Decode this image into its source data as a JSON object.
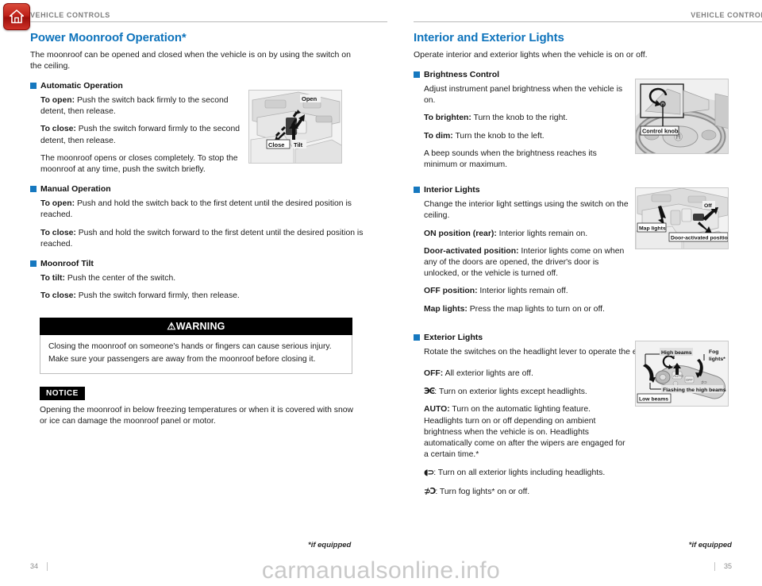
{
  "home_icon": {
    "name": "home-icon"
  },
  "left": {
    "header": "VEHICLE CONTROLS",
    "title": "Power Moonroof Operation*",
    "intro": "The moonroof can be opened and closed when the vehicle is on by using the switch on the ceiling.",
    "automatic": {
      "heading": "Automatic Operation",
      "p1_label": "To open:",
      "p1_text": " Push the switch back firmly to the second detent, then release.",
      "p2_label": "To close:",
      "p2_text": " Push the switch forward firmly to the second detent, then release.",
      "p3_text": "The moonroof opens or closes completely. To stop the moonroof at any time, push the switch briefly."
    },
    "manual": {
      "heading": "Manual Operation",
      "p1_label": "To open:",
      "p1_text": " Push and hold the switch back to the first detent until the desired position is reached.",
      "p2_label": "To close:",
      "p2_text": " Push and hold the switch forward  to the first detent until the desired position is reached."
    },
    "tilt": {
      "heading": "Moonroof Tilt",
      "p1_label": "To tilt:",
      "p1_text": " Push the center of the switch.",
      "p2_label": "To close:",
      "p2_text": " Push the switch forward firmly, then release."
    },
    "warning": {
      "bar": "⚠WARNING",
      "line1": "Closing the moonroof on someone's hands or fingers can cause serious injury.",
      "line2": "Make sure your passengers are away from the moonroof before closing it."
    },
    "notice": {
      "tag": "NOTICE",
      "body": "Opening the moonroof in below freezing temperatures or when it is covered with snow or ice can damage the moonroof panel or motor."
    },
    "figure_moonroof": {
      "name": "moonroof-switch-illustration",
      "labels": {
        "open": "Open",
        "close": "Close",
        "tilt": "Tilt"
      }
    },
    "footnote": "*if equipped",
    "page_number": "34"
  },
  "right": {
    "header": "VEHICLE CONTROLS",
    "title": "Interior and Exterior Lights",
    "intro": "Operate interior and exterior lights when the vehicle is on or off.",
    "brightness": {
      "heading": "Brightness Control",
      "p1_text": "Adjust instrument panel brightness when the vehicle is on.",
      "p2_label": "To brighten:",
      "p2_text": " Turn the knob to the right.",
      "p3_label": "To dim:",
      "p3_text": " Turn the knob to the left.",
      "p4_text": "A beep sounds when the brightness reaches its minimum or maximum."
    },
    "interior": {
      "heading": "Interior Lights",
      "p1_text": "Change the interior light settings using the switch on the ceiling.",
      "p2_label": "ON position (rear):",
      "p2_text": " Interior lights remain on.",
      "p3_label": "Door-activated position:",
      "p3_text": " Interior lights come on when any of the doors are opened, the driver's door is unlocked, or the vehicle is turned off.",
      "p4_label": "OFF position:",
      "p4_text": " Interior lights remain off.",
      "p5_label": "Map lights:",
      "p5_text": " Press the map lights to turn on or off."
    },
    "exterior": {
      "heading": "Exterior Lights",
      "p1_text": "Rotate the switches on the headlight lever to operate the exterior lights.",
      "off_label": "OFF:",
      "off_text": "  All exterior lights are off.",
      "park_symbol": "ЭϾ",
      "park_text": ":  Turn on exterior lights except headlights.",
      "auto_label": "AUTO:",
      "auto_text": "  Turn on the automatic lighting feature. Headlights turn on or off depending on ambient brightness when the vehicle is on. Headlights automatically come on after the wipers are engaged for a certain time.*",
      "head_symbol": "◖⊃",
      "head_text": ":  Turn on all exterior lights including headlights.",
      "fog_symbol": "⊅Ɔ",
      "fog_text": ":  Turn fog lights* on or off."
    },
    "figure_brightness": {
      "name": "brightness-control-knob-illustration",
      "labels": {
        "knob": "Control knob"
      }
    },
    "figure_interior": {
      "name": "interior-lights-switch-illustration",
      "labels": {
        "map": "Map lights",
        "off": "Off",
        "door": "Door-activated position"
      }
    },
    "figure_exterior": {
      "name": "headlight-lever-illustration",
      "labels": {
        "high": "High beams",
        "fog": "Fog lights*",
        "flash": "Flashing the high beams",
        "low": "Low beams"
      }
    },
    "footnote": "*if equipped",
    "page_number": "35"
  },
  "watermark": "carmanualsonline.info",
  "colors": {
    "heading_blue": "#0f74bc",
    "bullet_blue": "#1678bf",
    "header_gray": "#7e7e7e",
    "home_red": "#c0211a"
  }
}
